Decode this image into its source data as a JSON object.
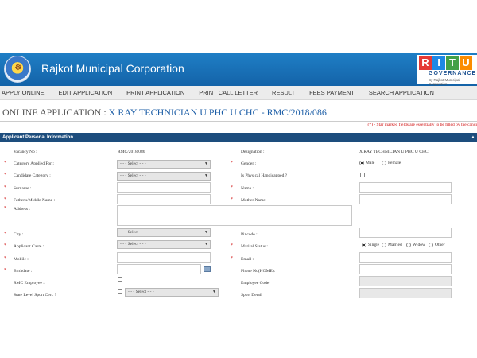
{
  "header": {
    "org_title": "Rajkot Municipal Corporation",
    "logo_icon": "rmc-emblem-icon",
    "ritu_letters": [
      "R",
      "I",
      "T",
      "U"
    ],
    "ritu_colors": [
      "#e53935",
      "#1e88e5",
      "#43a047",
      "#fb8c00"
    ],
    "ritu_governance": "GOVERNANCE",
    "ritu_by": "By Rajkot Municipal Corporation"
  },
  "nav": {
    "items": [
      "APPLY ONLINE",
      "EDIT APPLICATION",
      "PRINT APPLICATION",
      "PRINT CALL LETTER",
      "RESULT",
      "FEES PAYMENT",
      "SEARCH APPLICATION"
    ]
  },
  "page": {
    "title_prefix": "ONLINE APPLICATION : ",
    "title_code": "X RAY TECHNICIAN U PHC U CHC - RMC/2018/086",
    "required_note": "(*) - Star marked fields are essentially to be filled by the candi"
  },
  "section": {
    "title": "Applicant Personal Information",
    "toggle": "▲"
  },
  "form": {
    "vacancy_label": "Vacancy No :",
    "vacancy_value": "RMC/2018/086",
    "designation_label": "Designation :",
    "designation_value": "X RAY TECHNICIAN U PHC U CHC",
    "category_label": "Category Applied For :",
    "category_select": "- - - Select - - -",
    "gender_label": "Gender :",
    "gender_options": [
      "Male",
      "Female"
    ],
    "candidate_category_label": "Candidate Category :",
    "candidate_category_select": "- - - Select - - -",
    "handicapped_label": "Is Physical Handicapped ?",
    "surname_label": "Surname :",
    "name_label": "Name :",
    "father_label": "Father's/Middle Name :",
    "mother_label": "Mother Name:",
    "address_label": "Address :",
    "city_label": "City :",
    "city_select": "- - - Select - - -",
    "pincode_label": "Pincode :",
    "caste_label": "Applicant Caste :",
    "caste_select": "- - - Select - - -",
    "marital_label": "Marital Status :",
    "marital_options": [
      "Single",
      "Married",
      "Widow",
      "Other"
    ],
    "mobile_label": "Mobile :",
    "email_label": "Email :",
    "birthdate_label": "Birthdate :",
    "phone_label": "Phone No(HOME):",
    "rmc_employee_label": "RMC Employee :",
    "employee_code_label": "Employee Code",
    "sport_cert_label": "State Level Sport Cert. ?",
    "sport_select": "- - - Select - - -",
    "sport_detail_label": "Sport Detail",
    "required_star": "*"
  }
}
